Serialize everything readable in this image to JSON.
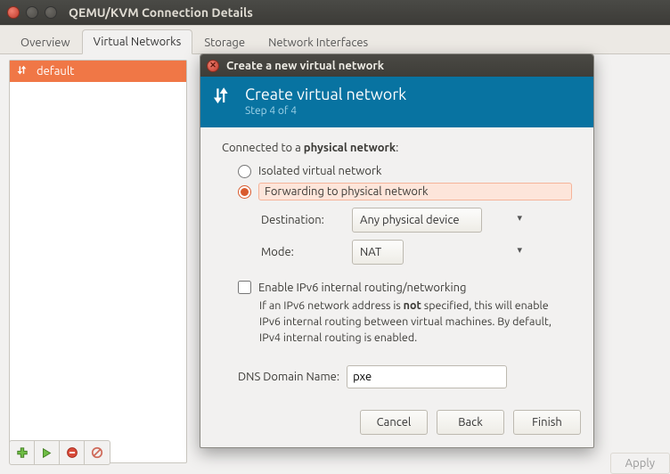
{
  "parent_window": {
    "title": "QEMU/KVM Connection Details",
    "tabs": [
      {
        "label": "Overview",
        "active": false
      },
      {
        "label": "Virtual Networks",
        "active": true
      },
      {
        "label": "Storage",
        "active": false
      },
      {
        "label": "Network Interfaces",
        "active": false
      }
    ],
    "network_list": [
      {
        "name": "default",
        "selected": true
      }
    ],
    "toolbar_icons": [
      "add",
      "start",
      "stop",
      "delete"
    ],
    "apply_label": "Apply"
  },
  "dialog": {
    "titlebar": "Create a new virtual network",
    "banner_title": "Create virtual network",
    "step_label": "Step 4 of 4",
    "heading_prefix": "Connected to a ",
    "heading_bold": "physical network",
    "heading_suffix": ":",
    "radio_isolated": "Isolated virtual network",
    "radio_forward": "Forwarding to physical network",
    "selected_radio": "forward",
    "destination_label": "Destination:",
    "destination_value": "Any physical device",
    "mode_label": "Mode:",
    "mode_value": "NAT",
    "ipv6_checkbox_label": "Enable IPv6 internal routing/networking",
    "ipv6_checked": false,
    "ipv6_help_pre": "If an IPv6 network address is ",
    "ipv6_help_bold": "not",
    "ipv6_help_post": " specified, this will enable IPv6 internal routing between virtual machines. By default, IPv4 internal routing is enabled.",
    "dns_label": "DNS Domain Name:",
    "dns_value": "pxe",
    "buttons": {
      "cancel": "Cancel",
      "back": "Back",
      "finish": "Finish"
    }
  }
}
